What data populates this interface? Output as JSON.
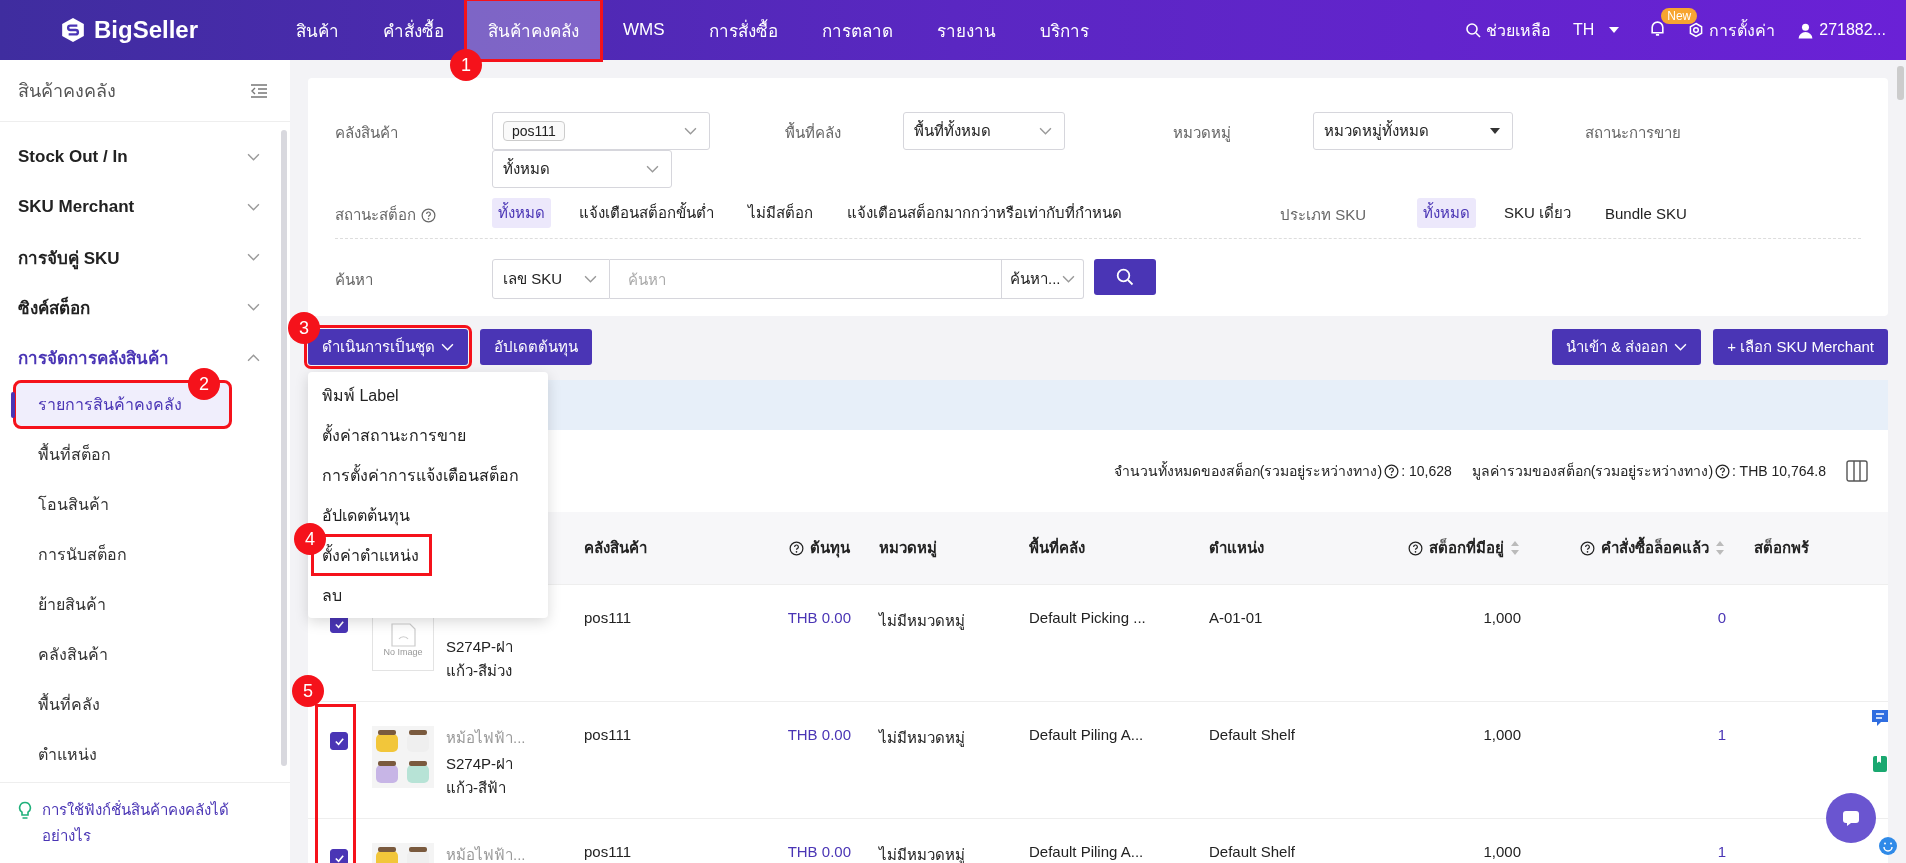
{
  "topbar": {
    "logo": "BigSeller",
    "nav": [
      {
        "label": "สินค้า",
        "selected": false
      },
      {
        "label": "คำสั่งซื้อ",
        "selected": false
      },
      {
        "label": "สินค้าคงคลัง",
        "selected": true,
        "callout": "1"
      },
      {
        "label": "WMS",
        "selected": false
      },
      {
        "label": "การสั่งซื้อ",
        "selected": false
      },
      {
        "label": "การตลาด",
        "selected": false
      },
      {
        "label": "รายงาน",
        "selected": false
      },
      {
        "label": "บริการ",
        "selected": false
      }
    ],
    "help": "ช่วยเหลือ",
    "lang": "TH",
    "new_badge": "New",
    "settings": "การตั้งค่า",
    "user": "271882..."
  },
  "sidebar": {
    "title": "สินค้าคงคลัง",
    "groups": [
      {
        "label": "Stock Out / In",
        "expanded": false
      },
      {
        "label": "SKU Merchant",
        "expanded": false
      },
      {
        "label": "การจับคู่ SKU",
        "expanded": false
      },
      {
        "label": "ซิงค์สต็อก",
        "expanded": false
      },
      {
        "label": "การจัดการคลังสินค้า",
        "expanded": true,
        "children": [
          {
            "label": "รายการสินค้าคงคลัง",
            "selected": true,
            "callout": "2"
          },
          {
            "label": "พื้นที่สต็อก",
            "selected": false
          },
          {
            "label": "โอนสินค้า",
            "selected": false
          },
          {
            "label": "การนับสต็อก",
            "selected": false
          },
          {
            "label": "ย้ายสินค้า",
            "selected": false
          },
          {
            "label": "คลังสินค้า",
            "selected": false
          },
          {
            "label": "พื้นที่คลัง",
            "selected": false
          },
          {
            "label": "ตำแหน่ง",
            "selected": false
          }
        ]
      }
    ],
    "help_link": "การใช้ฟังก์ชั่นสินค้าคงคลังได้อย่างไร"
  },
  "filters": {
    "warehouse": {
      "label": "คลังสินค้า",
      "tag": "pos111"
    },
    "area": {
      "label": "พื้นที่คลัง",
      "value": "พื้นที่ทั้งหมด"
    },
    "category": {
      "label": "หมวดหมู่",
      "value": "หมวดหมู่ทั้งหมด"
    },
    "sale_status": {
      "label": "สถานะการขาย",
      "value": "ทั้งหมด"
    },
    "stock_status": {
      "label": "สถานะสต็อก",
      "options": [
        {
          "label": "ทั้งหมด",
          "selected": true
        },
        {
          "label": "แจ้งเตือนสต็อกขั้นต่ำ",
          "selected": false
        },
        {
          "label": "ไม่มีสต็อก",
          "selected": false
        },
        {
          "label": "แจ้งเตือนสต็อกมากกว่าหรือเท่ากับที่กำหนด",
          "selected": false
        }
      ]
    },
    "sku_type": {
      "label": "ประเภท SKU",
      "options": [
        {
          "label": "ทั้งหมด",
          "selected": true
        },
        {
          "label": "SKU เดี่ยว",
          "selected": false
        },
        {
          "label": "Bundle SKU",
          "selected": false
        }
      ]
    },
    "search": {
      "label": "ค้นหา",
      "field": "เลข SKU",
      "placeholder": "ค้นหา",
      "mode": "ค้นหา..."
    }
  },
  "toolbar": {
    "batch": {
      "label": "ดำเนินการเป็นชุด",
      "callout": "3",
      "open": true,
      "items": [
        {
          "label": "พิมพ์ Label"
        },
        {
          "label": "ตั้งค่าสถานะการขาย"
        },
        {
          "label": "การตั้งค่าการแจ้งเตือนสต็อก"
        },
        {
          "label": "อัปเดตต้นทุน"
        },
        {
          "label": "ตั้งค่าตำแหน่ง",
          "callout": "4"
        },
        {
          "label": "ลบ"
        }
      ]
    },
    "update_cost": "อัปเดตต้นทุน",
    "import_export": "นำเข้า & ส่งออก",
    "add_sku": "+ เลือก SKU Merchant"
  },
  "summary": [
    {
      "label": "จำนวนทั้งหมดของสต็อก(รวมอยู่ระหว่างทาง)",
      "value": ": 10,628"
    },
    {
      "label": "มูลค่ารวมของสต็อก(รวมอยู่ระหว่างทาง)",
      "value": ": THB 10,764.8"
    }
  ],
  "table": {
    "checkbox_callout": "5",
    "columns": [
      {
        "label": "คลังสินค้า"
      },
      {
        "label": "ต้นทุน",
        "help": true
      },
      {
        "label": "หมวดหมู่"
      },
      {
        "label": "พื้นที่คลัง"
      },
      {
        "label": "ตำแหน่ง"
      },
      {
        "label": "สต็อกที่มีอยู่",
        "help": true,
        "sortable": true
      },
      {
        "label": "คำสั่งซื้อล็อคแล้ว",
        "help": true,
        "sortable": true
      },
      {
        "label": "สต็อกพร้"
      }
    ],
    "rows": [
      {
        "checked": true,
        "kind": "placeholder",
        "image_text": "No Image",
        "sku": "S274P-ฝาแก้ว-สีม่วง",
        "warehouse": "pos111",
        "cost": "THB 0.00",
        "category": "ไม่มีหมวดหมู่",
        "area": "Default Picking ...",
        "location": "A-01-01",
        "stock": "1,000",
        "locked": "0"
      },
      {
        "checked": true,
        "title": "หม้อไฟฟ้า...",
        "sku": "S274P-ฝาแก้ว-สีฟ้า",
        "warehouse": "pos111",
        "cost": "THB 0.00",
        "category": "ไม่มีหมวดหมู่",
        "area": "Default Piling A...",
        "location": "Default Shelf",
        "stock": "1,000",
        "locked": "1"
      },
      {
        "checked": true,
        "title": "หม้อไฟฟ้า...",
        "warehouse": "pos111",
        "cost": "THB 0.00",
        "category": "ไม่มีหมวดหมู่",
        "area": "Default Piling A...",
        "location": "Default Shelf",
        "stock": "1,000",
        "locked": "1"
      }
    ]
  }
}
